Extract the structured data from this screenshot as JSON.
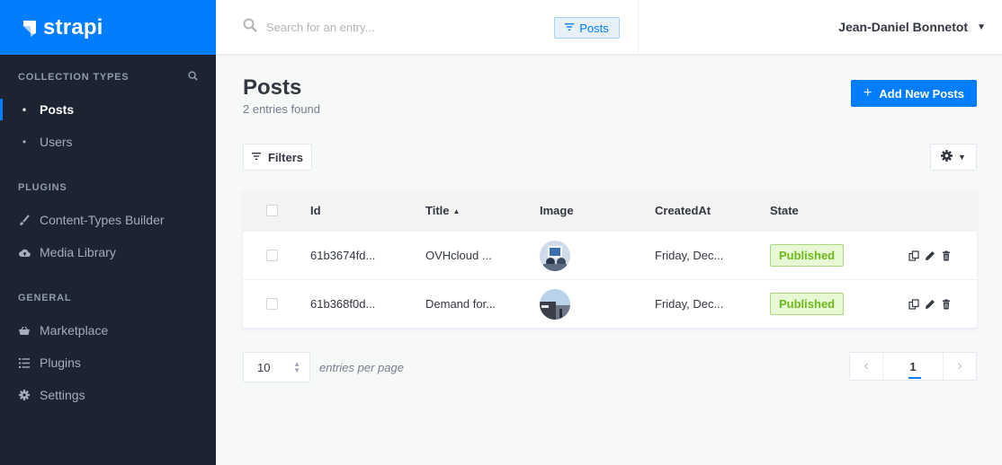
{
  "brand": {
    "name": "strapi",
    "color": "#007eff"
  },
  "sidebar": {
    "sections": [
      {
        "heading": "Collection Types",
        "items": [
          {
            "label": "Posts",
            "icon": "bullet-icon",
            "active": true
          },
          {
            "label": "Users",
            "icon": "bullet-icon"
          }
        ]
      },
      {
        "heading": "Plugins",
        "items": [
          {
            "label": "Content-Types Builder",
            "icon": "paintbrush-icon"
          },
          {
            "label": "Media Library",
            "icon": "cloud-upload-icon"
          }
        ]
      },
      {
        "heading": "General",
        "items": [
          {
            "label": "Marketplace",
            "icon": "basket-icon"
          },
          {
            "label": "Plugins",
            "icon": "list-icon"
          },
          {
            "label": "Settings",
            "icon": "gear-icon"
          }
        ]
      }
    ]
  },
  "header": {
    "search_placeholder": "Search for an entry...",
    "search_scope": "Posts",
    "user_name": "Jean-Daniel Bonnetot"
  },
  "main": {
    "title": "Posts",
    "subtitle": "2 entries found",
    "add_button": "Add New Posts",
    "filters_button": "Filters"
  },
  "table": {
    "columns": [
      "Id",
      "Title",
      "Image",
      "CreatedAt",
      "State"
    ],
    "sorted_column": "Title",
    "rows": [
      {
        "id": "61b3674fd...",
        "title": "OVHcloud ...",
        "created": "Friday, Dec...",
        "state": "Published"
      },
      {
        "id": "61b368f0d...",
        "title": "Demand for...",
        "created": "Friday, Dec...",
        "state": "Published"
      }
    ]
  },
  "footer": {
    "per_page_value": "10",
    "per_page_label": "entries per page",
    "current_page": "1"
  },
  "colors": {
    "accent": "#007eff",
    "sidebar_bg": "#1c2331",
    "published_bg": "#e6f8d4",
    "published_text": "#6dbb1a"
  }
}
